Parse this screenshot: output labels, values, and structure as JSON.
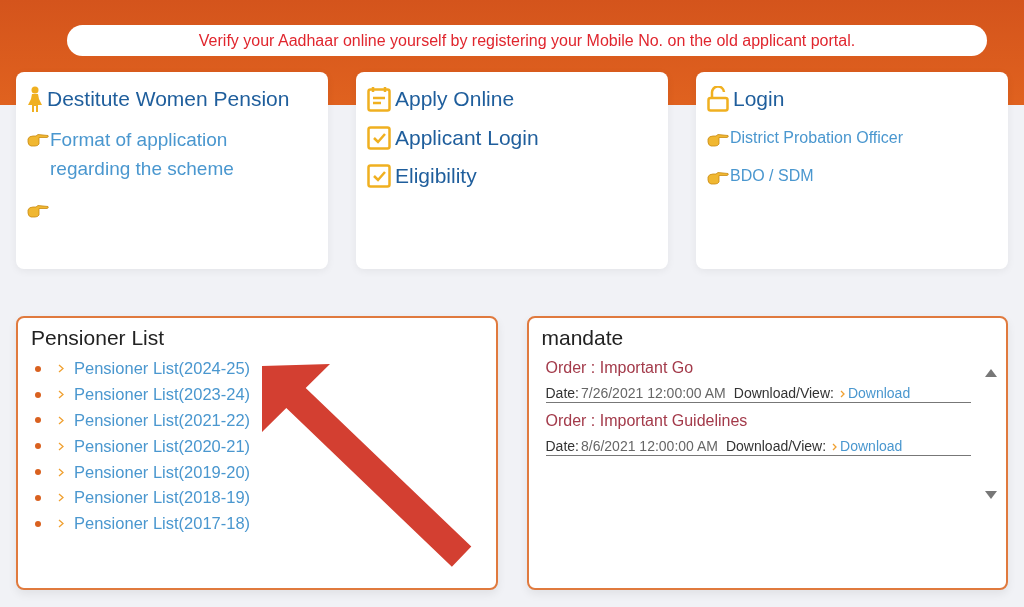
{
  "notice": "Verify your Aadhaar online yourself by registering your Mobile No. on the old applicant portal.",
  "cards": [
    {
      "entries": [
        {
          "kind": "person",
          "text": "Destitute Women Pension"
        },
        {
          "kind": "link",
          "text": "Format of application regarding the scheme"
        },
        {
          "kind": "pointer"
        }
      ]
    },
    {
      "entries": [
        {
          "kind": "calendar",
          "text": "Apply Online"
        },
        {
          "kind": "checkbox",
          "text": "Applicant Login"
        },
        {
          "kind": "checkbox",
          "text": "Eligibility"
        }
      ]
    },
    {
      "entries": [
        {
          "kind": "padlock",
          "text": "Login"
        },
        {
          "kind": "link",
          "text": "District Probation Officer"
        },
        {
          "kind": "link",
          "text": "BDO / SDM"
        }
      ]
    }
  ],
  "pensioner_list": {
    "title": "Pensioner List",
    "items": [
      "Pensioner List(2024-25)",
      "Pensioner List(2023-24)",
      "Pensioner List(2021-22)",
      "Pensioner List(2020-21)",
      "Pensioner List(2019-20)",
      "Pensioner List(2018-19)",
      "Pensioner List(2017-18)"
    ]
  },
  "mandate": {
    "title": "mandate",
    "orders": [
      {
        "title": "Order : Important Go",
        "date_label": "Date:",
        "date": "7/26/2021 12:00:00 AM",
        "download_label": "Download/View:",
        "link": "Download"
      },
      {
        "title": "Order : Important Guidelines",
        "date_label": "Date:",
        "date": "8/6/2021 12:00:00 AM",
        "download_label": "Download/View:",
        "link": "Download"
      }
    ]
  }
}
